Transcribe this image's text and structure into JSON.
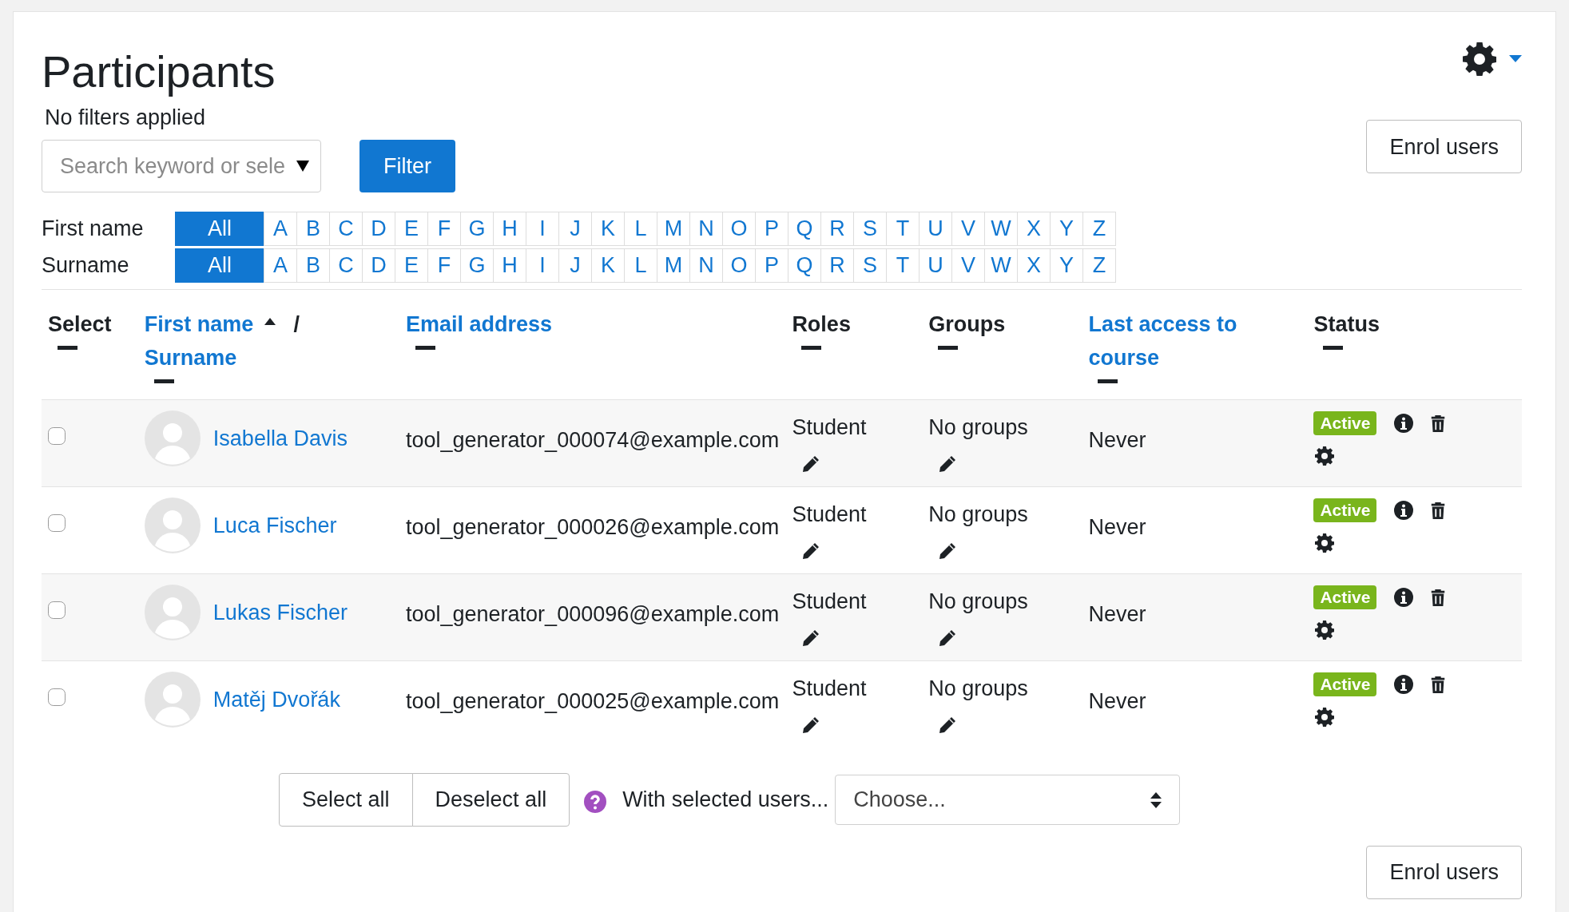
{
  "page": {
    "title": "Participants",
    "filter_status": "No filters applied"
  },
  "search": {
    "placeholder": "Search keyword or sele"
  },
  "filter_button": "Filter",
  "enrol_button_top": "Enrol users",
  "initials_bars": [
    {
      "label": "First name",
      "letters": [
        {
          "label": "All",
          "selected": true
        },
        {
          "label": "A",
          "selected": false
        },
        {
          "label": "B",
          "selected": false
        },
        {
          "label": "C",
          "selected": false
        },
        {
          "label": "D",
          "selected": false
        },
        {
          "label": "E",
          "selected": false
        },
        {
          "label": "F",
          "selected": false
        },
        {
          "label": "G",
          "selected": false
        },
        {
          "label": "H",
          "selected": false
        },
        {
          "label": "I",
          "selected": false
        },
        {
          "label": "J",
          "selected": false
        },
        {
          "label": "K",
          "selected": false
        },
        {
          "label": "L",
          "selected": false
        },
        {
          "label": "M",
          "selected": false
        },
        {
          "label": "N",
          "selected": false
        },
        {
          "label": "O",
          "selected": false
        },
        {
          "label": "P",
          "selected": false
        },
        {
          "label": "Q",
          "selected": false
        },
        {
          "label": "R",
          "selected": false
        },
        {
          "label": "S",
          "selected": false
        },
        {
          "label": "T",
          "selected": false
        },
        {
          "label": "U",
          "selected": false
        },
        {
          "label": "V",
          "selected": false
        },
        {
          "label": "W",
          "selected": false
        },
        {
          "label": "X",
          "selected": false
        },
        {
          "label": "Y",
          "selected": false
        },
        {
          "label": "Z",
          "selected": false
        }
      ]
    },
    {
      "label": "Surname",
      "letters": [
        {
          "label": "All",
          "selected": true
        },
        {
          "label": "A",
          "selected": false
        },
        {
          "label": "B",
          "selected": false
        },
        {
          "label": "C",
          "selected": false
        },
        {
          "label": "D",
          "selected": false
        },
        {
          "label": "E",
          "selected": false
        },
        {
          "label": "F",
          "selected": false
        },
        {
          "label": "G",
          "selected": false
        },
        {
          "label": "H",
          "selected": false
        },
        {
          "label": "I",
          "selected": false
        },
        {
          "label": "J",
          "selected": false
        },
        {
          "label": "K",
          "selected": false
        },
        {
          "label": "L",
          "selected": false
        },
        {
          "label": "M",
          "selected": false
        },
        {
          "label": "N",
          "selected": false
        },
        {
          "label": "O",
          "selected": false
        },
        {
          "label": "P",
          "selected": false
        },
        {
          "label": "Q",
          "selected": false
        },
        {
          "label": "R",
          "selected": false
        },
        {
          "label": "S",
          "selected": false
        },
        {
          "label": "T",
          "selected": false
        },
        {
          "label": "U",
          "selected": false
        },
        {
          "label": "V",
          "selected": false
        },
        {
          "label": "W",
          "selected": false
        },
        {
          "label": "X",
          "selected": false
        },
        {
          "label": "Y",
          "selected": false
        },
        {
          "label": "Z",
          "selected": false
        }
      ]
    }
  ],
  "table": {
    "columns": [
      {
        "kind": "plain",
        "label": "Select"
      },
      {
        "kind": "name",
        "label": "First name",
        "label_2": "Surname",
        "separator": "/"
      },
      {
        "kind": "link",
        "label": "Email address"
      },
      {
        "kind": "plain",
        "label": "Roles"
      },
      {
        "kind": "plain",
        "label": "Groups"
      },
      {
        "kind": "link",
        "label": "Last access to course"
      },
      {
        "kind": "plain",
        "label": "Status"
      }
    ],
    "rows": [
      {
        "checked": false,
        "name": "Isabella Davis",
        "email": "tool_generator_000074@example.com",
        "roles": "Student",
        "groups": "No groups",
        "last_access": "Never",
        "status": "Active"
      },
      {
        "checked": false,
        "name": "Luca Fischer",
        "email": "tool_generator_000026@example.com",
        "roles": "Student",
        "groups": "No groups",
        "last_access": "Never",
        "status": "Active"
      },
      {
        "checked": false,
        "name": "Lukas Fischer",
        "email": "tool_generator_000096@example.com",
        "roles": "Student",
        "groups": "No groups",
        "last_access": "Never",
        "status": "Active"
      },
      {
        "checked": false,
        "name": "Matěj Dvořák",
        "email": "tool_generator_000025@example.com",
        "roles": "Student",
        "groups": "No groups",
        "last_access": "Never",
        "status": "Active"
      }
    ]
  },
  "bulk": {
    "select_all": "Select all",
    "deselect_all": "Deselect all",
    "label": "With selected users...",
    "select_value": "Choose..."
  },
  "enrol_button_bottom": "Enrol users"
}
